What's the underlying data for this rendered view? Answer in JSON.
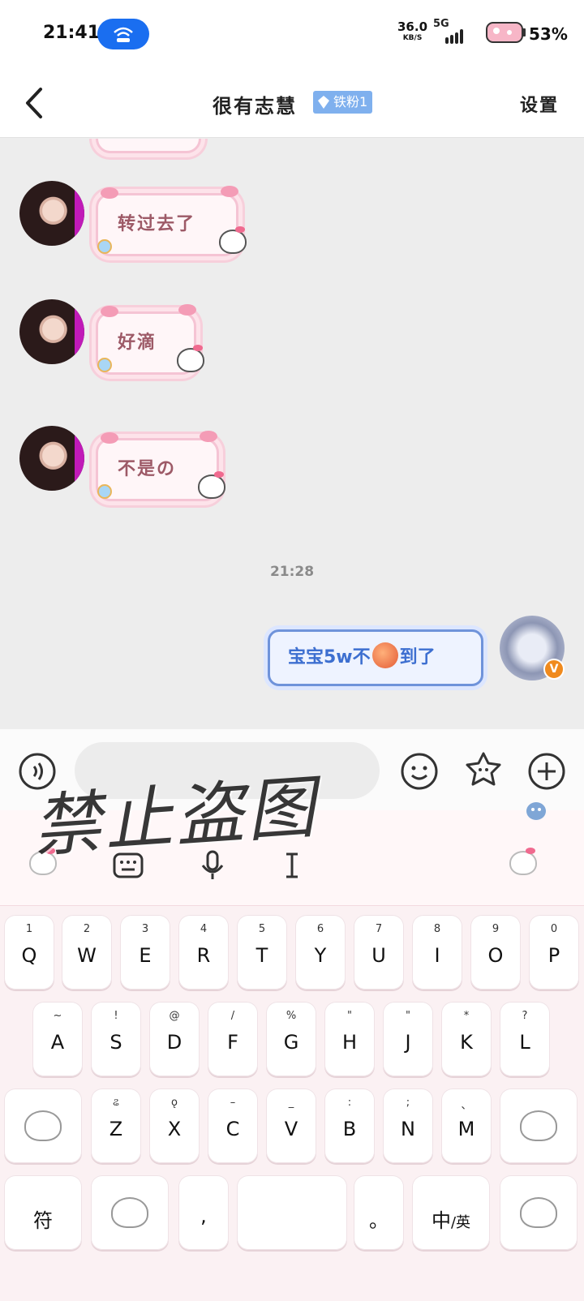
{
  "status_bar": {
    "time": "21:41",
    "speed_value": "36.0",
    "speed_unit": "KB/S",
    "network": "5G",
    "battery": "53%"
  },
  "header": {
    "contact_name": "很有志慧",
    "fan_badge": "铁粉1",
    "settings_label": "设置"
  },
  "messages": [
    {
      "text": "转过去了"
    },
    {
      "text": "好滴"
    },
    {
      "text": "不是の"
    }
  ],
  "timestamp": "21:28",
  "my_message": {
    "text_before": "宝宝5w不",
    "emoji": "peach-icon",
    "text_after": "到了"
  },
  "watermark": "禁止盗图",
  "keyboard": {
    "row1": [
      {
        "k": "Q",
        "s": "1"
      },
      {
        "k": "W",
        "s": "2"
      },
      {
        "k": "E",
        "s": "3"
      },
      {
        "k": "R",
        "s": "4"
      },
      {
        "k": "T",
        "s": "5"
      },
      {
        "k": "Y",
        "s": "6"
      },
      {
        "k": "U",
        "s": "7"
      },
      {
        "k": "I",
        "s": "8"
      },
      {
        "k": "O",
        "s": "9"
      },
      {
        "k": "P",
        "s": "0"
      }
    ],
    "row2": [
      {
        "k": "A",
        "s": "~"
      },
      {
        "k": "S",
        "s": "!"
      },
      {
        "k": "D",
        "s": "@"
      },
      {
        "k": "F",
        "s": "/"
      },
      {
        "k": "G",
        "s": "%"
      },
      {
        "k": "H",
        "s": "\""
      },
      {
        "k": "J",
        "s": "\""
      },
      {
        "k": "K",
        "s": "*"
      },
      {
        "k": "L",
        "s": "?"
      }
    ],
    "row3": [
      {
        "k": "Z",
        "s": "ଌ"
      },
      {
        "k": "X",
        "s": "ǫ"
      },
      {
        "k": "C",
        "s": "–"
      },
      {
        "k": "V",
        "s": "_"
      },
      {
        "k": "B",
        "s": ":"
      },
      {
        "k": "N",
        "s": ";"
      },
      {
        "k": "M",
        "s": "、"
      }
    ],
    "symbol_key": "符",
    "comma_key": ",",
    "period_key": "。",
    "lang_key_main": "中",
    "lang_key_alt": "/英"
  },
  "colors": {
    "pink_text": "#9d5a67",
    "blue_text": "#3d6fd0",
    "hotspot_blue": "#1a6ef0",
    "badge_blue": "#7fb0ee"
  }
}
